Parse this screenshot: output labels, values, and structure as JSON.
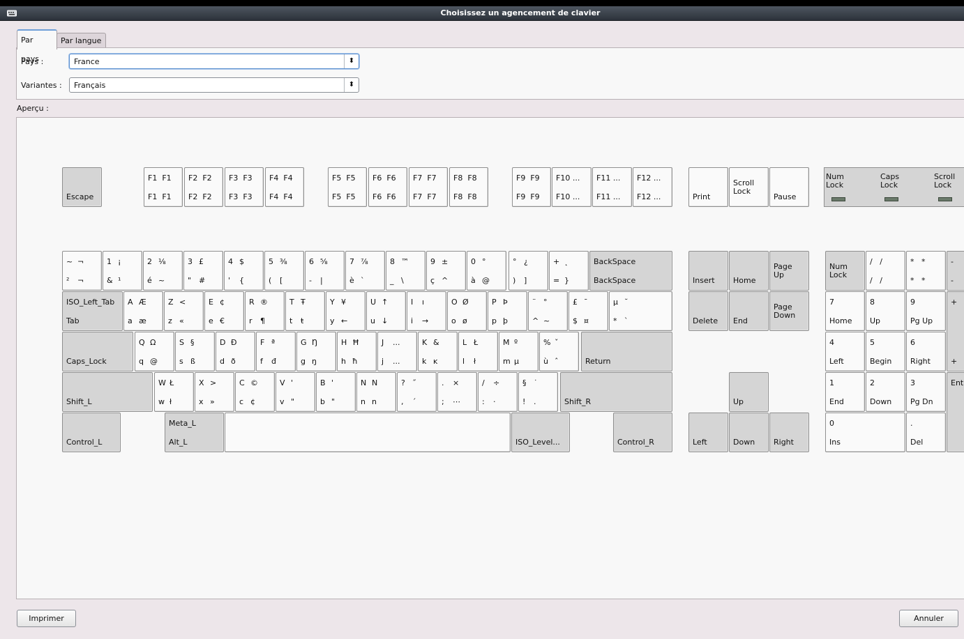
{
  "window": {
    "title": "Choisissez un agencement de clavier",
    "icon": "keyboard-icon"
  },
  "tabs": [
    {
      "label": "Par pays"
    },
    {
      "label": "Par langue"
    }
  ],
  "form": {
    "country_label": "Pays :",
    "country_value": "France",
    "variant_label": "Variantes :",
    "variant_value": "Français"
  },
  "preview_label": "Aperçu :",
  "keyboard": {
    "escape": {
      "b": "Escape"
    },
    "fkeys": [
      {
        "t": "F1  F1",
        "b": "F1  F1"
      },
      {
        "t": "F2  F2",
        "b": "F2  F2"
      },
      {
        "t": "F3  F3",
        "b": "F3  F3"
      },
      {
        "t": "F4  F4",
        "b": "F4  F4"
      },
      {
        "t": "F5  F5",
        "b": "F5  F5"
      },
      {
        "t": "F6  F6",
        "b": "F6  F6"
      },
      {
        "t": "F7  F7",
        "b": "F7  F7"
      },
      {
        "t": "F8  F8",
        "b": "F8  F8"
      },
      {
        "t": "F9  F9",
        "b": "F9  F9"
      },
      {
        "t": "F10 ...",
        "b": "F10 ..."
      },
      {
        "t": "F11 ...",
        "b": "F11 ..."
      },
      {
        "t": "F12 ...",
        "b": "F12 ..."
      }
    ],
    "sys": [
      {
        "b": "Print"
      },
      {
        "m": "Scroll\nLock"
      },
      {
        "b": "Pause"
      }
    ],
    "leds": {
      "num": "Num\nLock",
      "caps": "Caps\nLock",
      "scroll": "Scroll\nLock"
    },
    "row1": [
      {
        "tl": "~",
        "tr": "¬",
        "bl": "²",
        "br": "¬"
      },
      {
        "tl": "1",
        "tr": "¡",
        "bl": "&",
        "br": "¹"
      },
      {
        "tl": "2",
        "tr": "⅛",
        "bl": "é",
        "br": "~"
      },
      {
        "tl": "3",
        "tr": "£",
        "bl": "\"",
        "br": "#"
      },
      {
        "tl": "4",
        "tr": "$",
        "bl": "'",
        "br": "{"
      },
      {
        "tl": "5",
        "tr": "⅜",
        "bl": "(",
        "br": "["
      },
      {
        "tl": "6",
        "tr": "⅝",
        "bl": "-",
        "br": "|"
      },
      {
        "tl": "7",
        "tr": "⅞",
        "bl": "è",
        "br": "`"
      },
      {
        "tl": "8",
        "tr": "™",
        "bl": "_",
        "br": "\\"
      },
      {
        "tl": "9",
        "tr": "±",
        "bl": "ç",
        "br": "^"
      },
      {
        "tl": "0",
        "tr": "°",
        "bl": "à",
        "br": "@"
      },
      {
        "tl": "°",
        "tr": "¿",
        "bl": ")",
        "br": "]"
      },
      {
        "tl": "+",
        "tr": "˛",
        "bl": "=",
        "br": "}"
      },
      {
        "tl": "BackSpace",
        "bl": "BackSpace"
      }
    ],
    "row2": [
      {
        "tl": "ISO_Left_Tab",
        "bl": "Tab"
      },
      {
        "tl": "A",
        "tr": "Æ",
        "bl": "a",
        "br": "æ"
      },
      {
        "tl": "Z",
        "tr": "<",
        "bl": "z",
        "br": "«"
      },
      {
        "tl": "E",
        "tr": "¢",
        "bl": "e",
        "br": "€"
      },
      {
        "tl": "R",
        "tr": "®",
        "bl": "r",
        "br": "¶"
      },
      {
        "tl": "T",
        "tr": "Ŧ",
        "bl": "t",
        "br": "ŧ"
      },
      {
        "tl": "Y",
        "tr": "¥",
        "bl": "y",
        "br": "←"
      },
      {
        "tl": "U",
        "tr": "↑",
        "bl": "u",
        "br": "↓"
      },
      {
        "tl": "I",
        "tr": "ı",
        "bl": "i",
        "br": "→"
      },
      {
        "tl": "O",
        "tr": "Ø",
        "bl": "o",
        "br": "ø"
      },
      {
        "tl": "P",
        "tr": "Þ",
        "bl": "p",
        "br": "þ"
      },
      {
        "tl": "¨",
        "tr": "°",
        "bl": "^",
        "br": "~"
      },
      {
        "tl": "£",
        "tr": "¯",
        "bl": "$",
        "br": "¤"
      },
      {
        "tl": "µ",
        "tr": "˘",
        "bl": "*",
        "br": "`"
      }
    ],
    "row3": [
      {
        "bl": "Caps_Lock"
      },
      {
        "tl": "Q",
        "tr": "Ω",
        "bl": "q",
        "br": "@"
      },
      {
        "tl": "S",
        "tr": "§",
        "bl": "s",
        "br": "ß"
      },
      {
        "tl": "D",
        "tr": "Ð",
        "bl": "d",
        "br": "ð"
      },
      {
        "tl": "F",
        "tr": "ª",
        "bl": "f",
        "br": "đ"
      },
      {
        "tl": "G",
        "tr": "Ŋ",
        "bl": "g",
        "br": "ŋ"
      },
      {
        "tl": "H",
        "tr": "Ħ",
        "bl": "h",
        "br": "ħ"
      },
      {
        "tl": "J",
        "tr": "...",
        "bl": "j",
        "br": "..."
      },
      {
        "tl": "K",
        "tr": "&",
        "bl": "k",
        "br": "ĸ"
      },
      {
        "tl": "L",
        "tr": "Ł",
        "bl": "l",
        "br": "ł"
      },
      {
        "tl": "M",
        "tr": "º",
        "bl": "m",
        "br": "µ"
      },
      {
        "tl": "%",
        "tr": "ˇ",
        "bl": "ù",
        "br": "ˆ"
      },
      {
        "bl": "Return"
      }
    ],
    "row4": [
      {
        "bl": "Shift_L"
      },
      {
        "tl": "W",
        "tr": "Ł",
        "bl": "w",
        "br": "ł"
      },
      {
        "tl": "X",
        "tr": ">",
        "bl": "x",
        "br": "»"
      },
      {
        "tl": "C",
        "tr": "©",
        "bl": "c",
        "br": "¢"
      },
      {
        "tl": "V",
        "tr": "'",
        "bl": "v",
        "br": "\""
      },
      {
        "tl": "B",
        "tr": "'",
        "bl": "b",
        "br": "\""
      },
      {
        "tl": "N",
        "tr": "N",
        "bl": "n",
        "br": "n"
      },
      {
        "tl": "?",
        "tr": "˝",
        "bl": ",",
        "br": "´"
      },
      {
        "tl": ".",
        "tr": "×",
        "bl": ";",
        "br": "⋯"
      },
      {
        "tl": "/",
        "tr": "÷",
        "bl": ":",
        "br": "·"
      },
      {
        "tl": "§",
        "tr": "˙",
        "bl": "!",
        "br": "."
      },
      {
        "bl": "Shift_R"
      }
    ],
    "row5": [
      {
        "bl": "Control_L"
      },
      {
        "tl": "Meta_L",
        "bl": "Alt_L"
      },
      {
        "bl": ""
      },
      {
        "bl": "ISO_Level..."
      },
      {
        "bl": "Control_R"
      }
    ],
    "nav": [
      {
        "b": "Insert"
      },
      {
        "b": "Home"
      },
      {
        "m": "Page\nUp"
      },
      {
        "b": "Delete"
      },
      {
        "b": "End"
      },
      {
        "m": "Page\nDown"
      },
      {
        "b": "Up"
      },
      {
        "b": "Left"
      },
      {
        "b": "Down"
      },
      {
        "b": "Right"
      }
    ],
    "numpad": [
      {
        "m": "Num\nLock"
      },
      {
        "t": "/   /",
        "b": "/   /"
      },
      {
        "t": "*   *",
        "b": "*   *"
      },
      {
        "t": "-",
        "b": "-"
      },
      {
        "t": "7",
        "b": "Home"
      },
      {
        "t": "8",
        "b": "Up"
      },
      {
        "t": "9",
        "b": "Pg Up"
      },
      {
        "t": "+",
        "b": "+"
      },
      {
        "t": "4",
        "b": "Left"
      },
      {
        "t": "5",
        "b": "Begin"
      },
      {
        "t": "6",
        "b": "Right"
      },
      {
        "t": "1",
        "b": "End"
      },
      {
        "t": "2",
        "b": "Down"
      },
      {
        "t": "3",
        "b": "Pg Dn"
      },
      {
        "t": "Ent"
      },
      {
        "t": "0",
        "b": "Ins"
      },
      {
        "t": ".",
        "b": "Del"
      }
    ]
  },
  "buttons": {
    "print": "Imprimer",
    "cancel": "Annuler"
  }
}
